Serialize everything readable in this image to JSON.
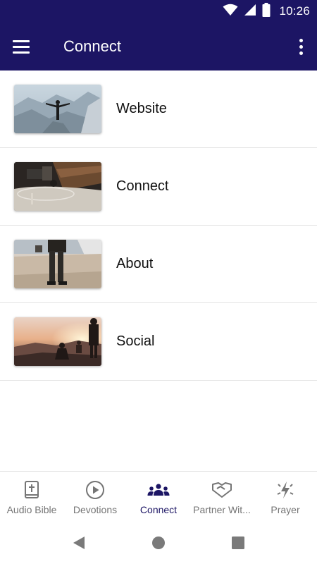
{
  "status_bar": {
    "time": "10:26"
  },
  "app_bar": {
    "title": "Connect"
  },
  "items": [
    {
      "label": "Website",
      "image": "person-on-mountain"
    },
    {
      "label": "Connect",
      "image": "living-room-rug"
    },
    {
      "label": "About",
      "image": "person-standing-beach"
    },
    {
      "label": "Social",
      "image": "sunset-silhouettes"
    }
  ],
  "bottom_nav": [
    {
      "label": "Audio Bible",
      "icon": "bible-icon",
      "active": false
    },
    {
      "label": "Devotions",
      "icon": "play-circle-icon",
      "active": false
    },
    {
      "label": "Connect",
      "icon": "group-icon",
      "active": true
    },
    {
      "label": "Partner Wit...",
      "icon": "handshake-icon",
      "active": false
    },
    {
      "label": "Prayer",
      "icon": "lightning-icon",
      "active": false
    }
  ],
  "colors": {
    "primary": "#1c1564",
    "inactive": "#757575"
  }
}
